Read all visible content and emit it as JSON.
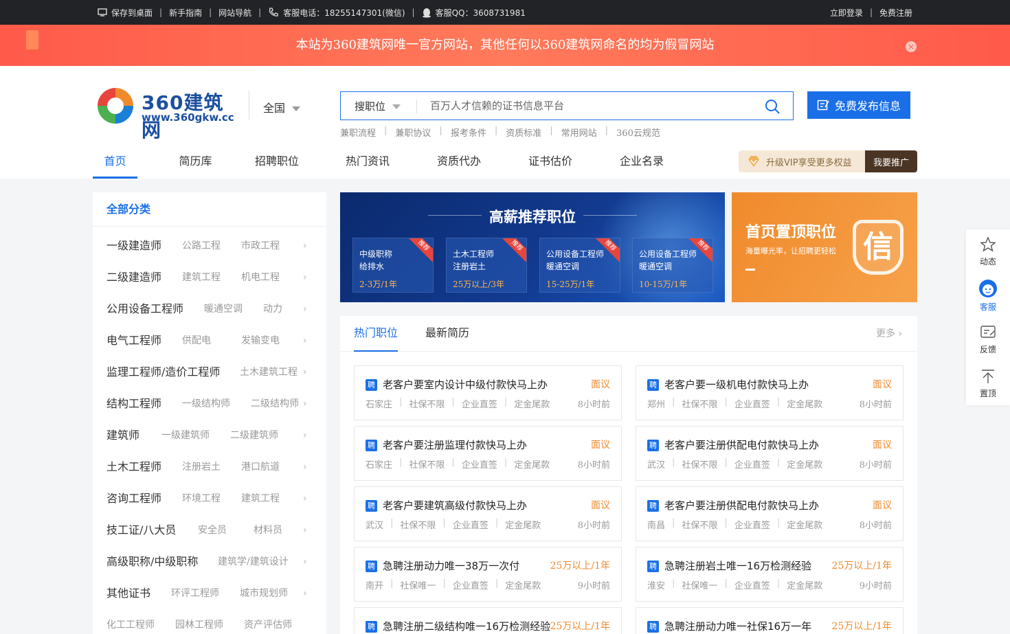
{
  "topbar": {
    "left_items": [
      {
        "label": "保存到桌面",
        "icon": "desktop-icon"
      },
      {
        "label": "新手指南"
      },
      {
        "label": "网站导航"
      },
      {
        "label": "客服电话：18255147301(微信)",
        "icon": "phone-icon"
      },
      {
        "label": "客服QQ：3608731981",
        "icon": "qq-icon"
      }
    ],
    "login": "立即登录",
    "register": "免费注册"
  },
  "notice": {
    "text": "本站为360建筑网唯一官方网站，其他任何以360建筑网命名的均为假冒网站",
    "close_icon": "×"
  },
  "header": {
    "brand": "360建筑网",
    "url": "www.360gkw.cc",
    "region": "全国",
    "search_type": "搜职位",
    "search_placeholder": "百万人才信赖的证书信息平台",
    "publish_label": "免费发布信息",
    "quick_links": [
      "兼职流程",
      "兼职协议",
      "报考条件",
      "资质标准",
      "常用网站",
      "360云规范"
    ],
    "nav": [
      "首页",
      "简历库",
      "招聘职位",
      "热门资讯",
      "资质代办",
      "证书估价",
      "企业名录"
    ],
    "vip_text": "升级VIP享受更多权益",
    "promote_label": "我要推广"
  },
  "categories": {
    "title": "全部分类",
    "items": [
      {
        "name": "一级建造师",
        "subs": [
          "公路工程",
          "市政工程"
        ]
      },
      {
        "name": "二级建造师",
        "subs": [
          "建筑工程",
          "机电工程"
        ]
      },
      {
        "name": "公用设备工程师",
        "subs": [
          "暖通空调",
          "动力"
        ]
      },
      {
        "name": "电气工程师",
        "subs": [
          "供配电",
          "发输变电"
        ]
      },
      {
        "name": "监理工程师/造价工程师",
        "subs": [
          "土木建筑工程"
        ]
      },
      {
        "name": "结构工程师",
        "subs": [
          "一级结构师",
          "二级结构师"
        ]
      },
      {
        "name": "建筑师",
        "subs": [
          "一级建筑师",
          "二级建筑师"
        ]
      },
      {
        "name": "土木工程师",
        "subs": [
          "注册岩土",
          "港口航道"
        ]
      },
      {
        "name": "咨询工程师",
        "subs": [
          "环境工程",
          "建筑工程"
        ]
      },
      {
        "name": "技工证/八大员",
        "subs": [
          "安全员",
          "材料员"
        ]
      },
      {
        "name": "高级职称/中级职称",
        "subs": [
          "建筑学/建筑设计"
        ]
      },
      {
        "name": "其他证书",
        "subs": [
          "环评工程师",
          "城市规划师"
        ]
      },
      {
        "name": "",
        "subs": [
          "化工工程师",
          "园林工程师",
          "资产评估师"
        ]
      }
    ]
  },
  "hot_banner": {
    "title": "高薪推荐职位",
    "tag": "推荐",
    "cards": [
      {
        "line1": "中级职称",
        "line2": "给排水",
        "pay": "2-3万/1年"
      },
      {
        "line1": "土木工程师",
        "line2": "注册岩土",
        "pay": "25万以上/3年"
      },
      {
        "line1": "公用设备工程师",
        "line2": "暖通空调",
        "pay": "15-25万/1年"
      },
      {
        "line1": "公用设备工程师",
        "line2": "暖通空调",
        "pay": "10-15万/1年"
      }
    ]
  },
  "top_banner": {
    "title": "首页置顶职位",
    "subtitle": "海量曝光率，让招聘更轻松",
    "badge": "信"
  },
  "listings": {
    "tabs": [
      "热门职位",
      "最新简历"
    ],
    "more": "更多",
    "pin_label": "聘",
    "jobs": [
      {
        "title": "老客户要室内设计中级付款快马上办",
        "pay": "面议",
        "meta": [
          "石家庄",
          "社保不限",
          "企业直签",
          "定金尾款"
        ],
        "time": "8小时前"
      },
      {
        "title": "老客户要一级机电付款快马上办",
        "pay": "面议",
        "meta": [
          "郑州",
          "社保不限",
          "企业直签",
          "定金尾款"
        ],
        "time": "8小时前"
      },
      {
        "title": "老客户要注册监理付款快马上办",
        "pay": "面议",
        "meta": [
          "石家庄",
          "社保不限",
          "企业直签",
          "定金尾款"
        ],
        "time": "8小时前"
      },
      {
        "title": "老客户要注册供配电付款快马上办",
        "pay": "面议",
        "meta": [
          "武汉",
          "社保不限",
          "企业直签",
          "定金尾款"
        ],
        "time": "8小时前"
      },
      {
        "title": "老客户要建筑高级付款快马上办",
        "pay": "面议",
        "meta": [
          "武汉",
          "社保不限",
          "企业直签",
          "定金尾款"
        ],
        "time": "8小时前"
      },
      {
        "title": "老客户要注册供配电付款快马上办",
        "pay": "面议",
        "meta": [
          "南昌",
          "社保不限",
          "企业直签",
          "定金尾款"
        ],
        "time": "8小时前"
      },
      {
        "title": "急聘注册动力唯一38万一次付",
        "pay": "25万以上/1年",
        "meta": [
          "南开",
          "社保唯一",
          "企业直签",
          "定金尾款"
        ],
        "time": "9小时前"
      },
      {
        "title": "急聘注册岩土唯一16万检测经验",
        "pay": "25万以上/1年",
        "meta": [
          "淮安",
          "社保唯一",
          "企业直签",
          "定金尾款"
        ],
        "time": "9小时前"
      },
      {
        "title": "急聘注册二级结构唯一16万检测经验",
        "pay": "25万以上/1年",
        "meta": [],
        "time": ""
      },
      {
        "title": "急聘注册动力唯一社保16万一年",
        "pay": "25万以上/1年",
        "meta": [],
        "time": ""
      }
    ]
  },
  "sidetool": [
    {
      "label": "动态",
      "icon": "star-icon"
    },
    {
      "label": "客服",
      "icon": "customer-service-icon"
    },
    {
      "label": "反馈",
      "icon": "feedback-icon"
    },
    {
      "label": "置顶",
      "icon": "back-to-top-icon"
    }
  ],
  "colors": {
    "primary": "#1a6fe8",
    "notice": "#ff5a4a",
    "accent": "#f08a2c",
    "topbar": "#222326"
  }
}
